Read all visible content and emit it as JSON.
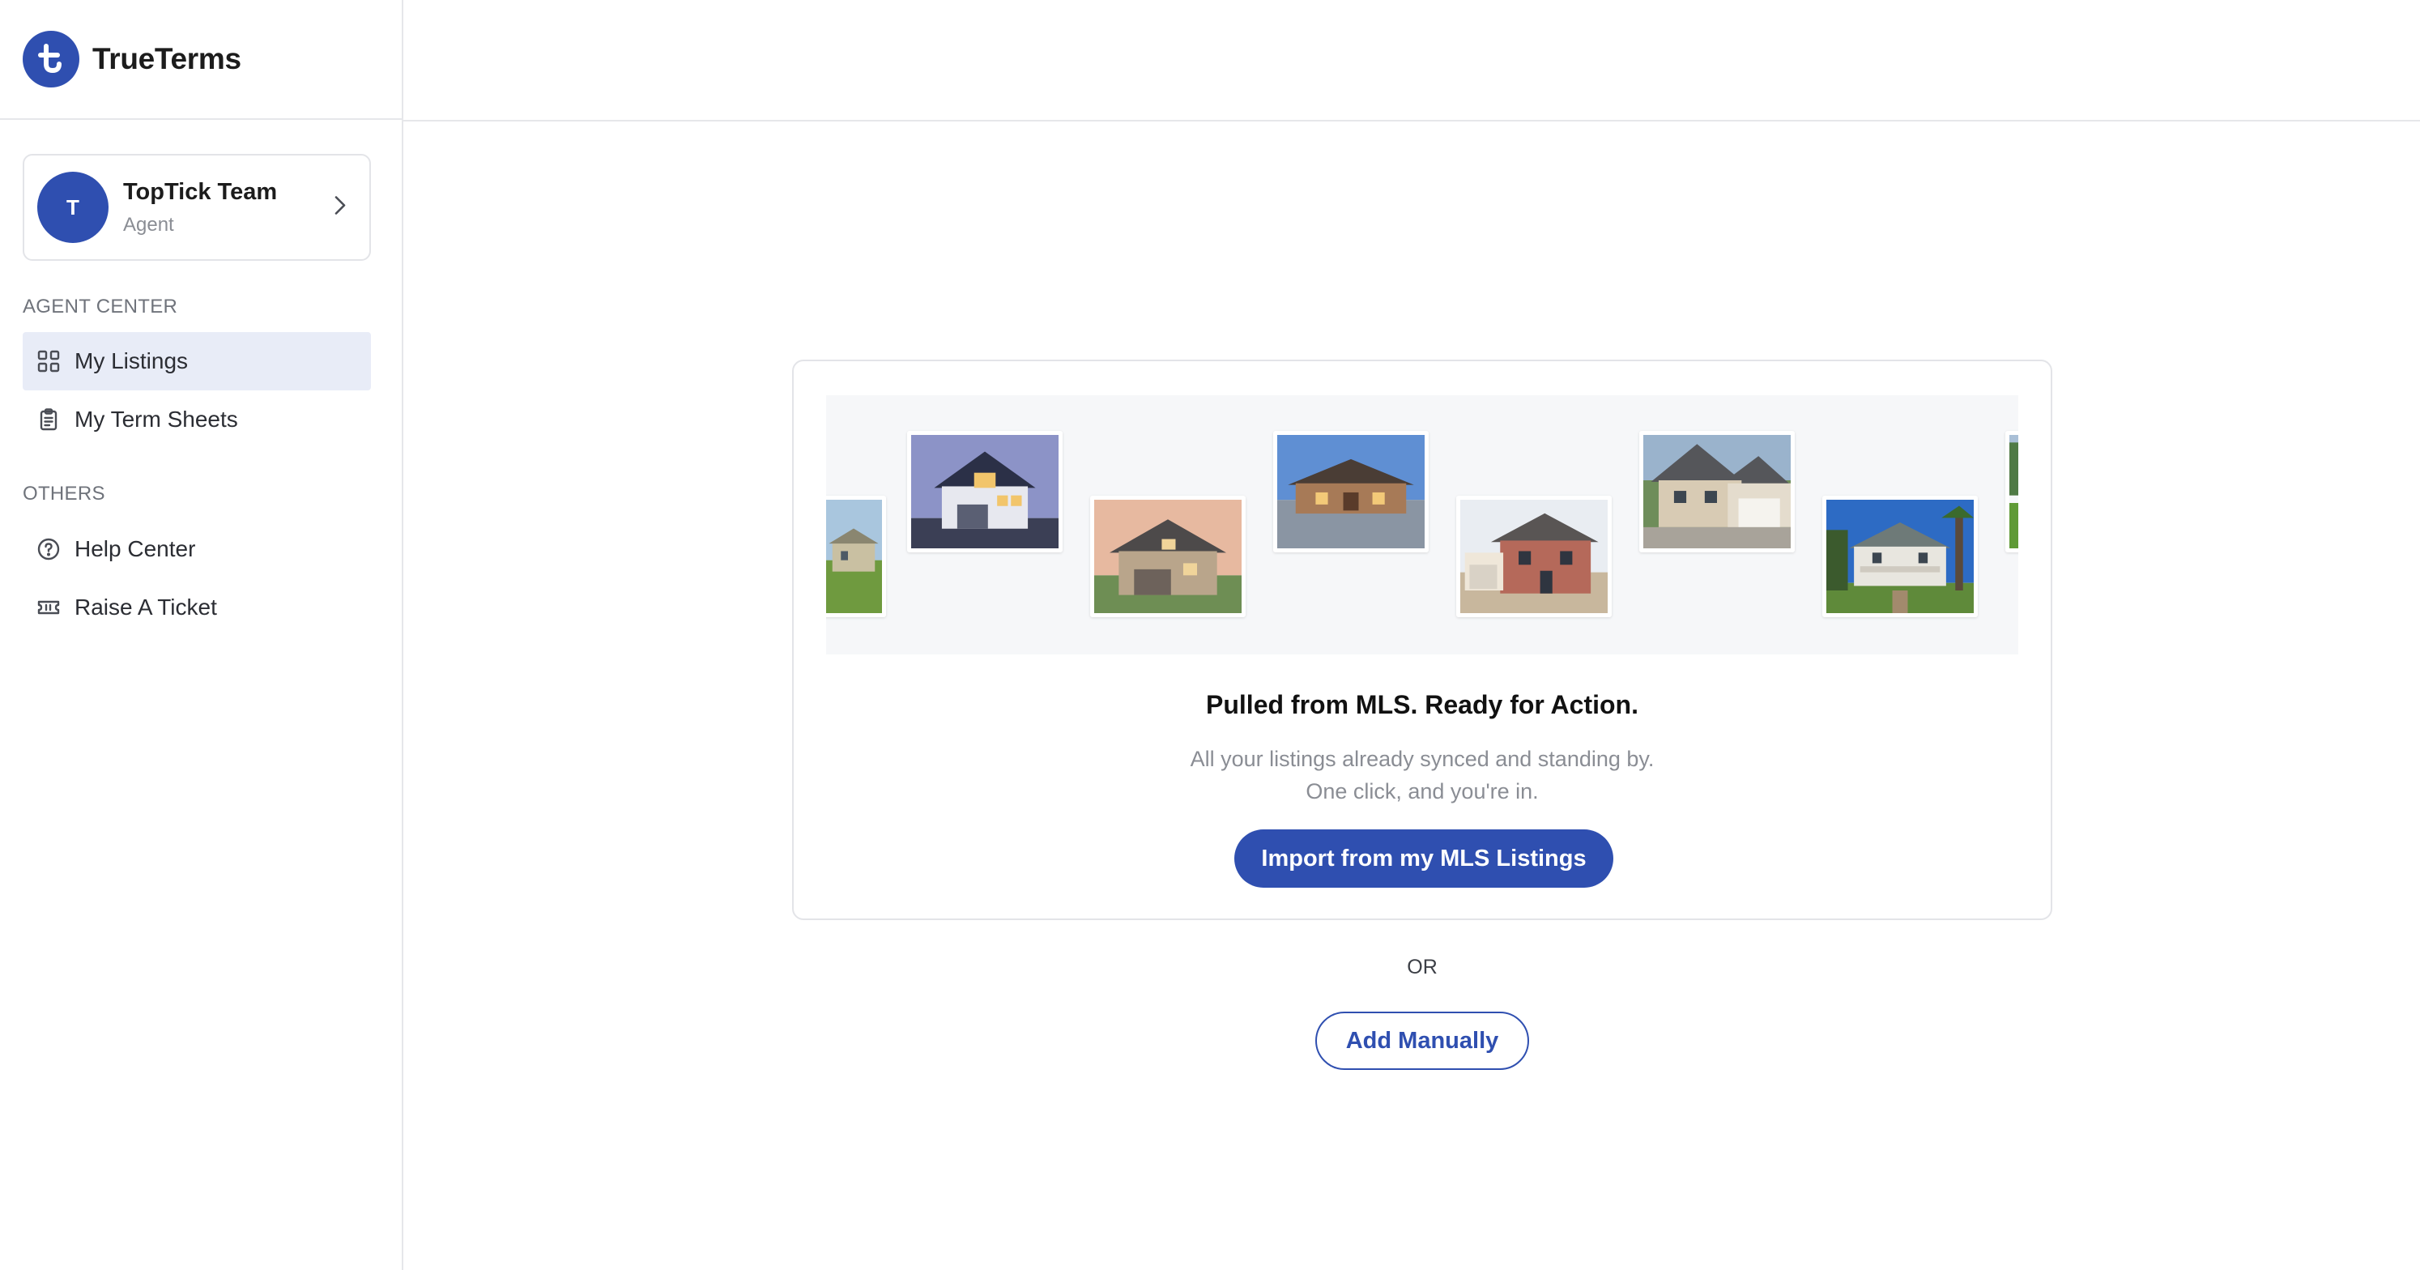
{
  "brand": {
    "name": "TrueTerms",
    "logo_icon": "trueterms-logo-icon",
    "color": "#2f4fb0"
  },
  "account": {
    "initial": "T",
    "name": "TopTick Team",
    "role": "Agent"
  },
  "sidebar": {
    "sections": [
      {
        "label": "AGENT CENTER",
        "items": [
          {
            "label": "My Listings",
            "icon": "grid-icon",
            "active": true
          },
          {
            "label": "My Term Sheets",
            "icon": "clipboard-icon",
            "active": false
          }
        ]
      },
      {
        "label": "OTHERS",
        "items": [
          {
            "label": "Help Center",
            "icon": "help-circle-icon",
            "active": false
          },
          {
            "label": "Raise A Ticket",
            "icon": "ticket-icon",
            "active": false
          }
        ]
      }
    ]
  },
  "main": {
    "card": {
      "title": "Pulled from MLS. Ready for Action.",
      "subtitle_line1": "All your listings already synced and standing by.",
      "subtitle_line2": "One click, and you're in.",
      "import_button": "Import from my MLS Listings"
    },
    "or_label": "OR",
    "add_manually_button": "Add Manually"
  },
  "colors": {
    "accent": "#2f4fb0",
    "active_nav_bg": "#e8ecf7",
    "muted_text": "#8a8d94"
  }
}
